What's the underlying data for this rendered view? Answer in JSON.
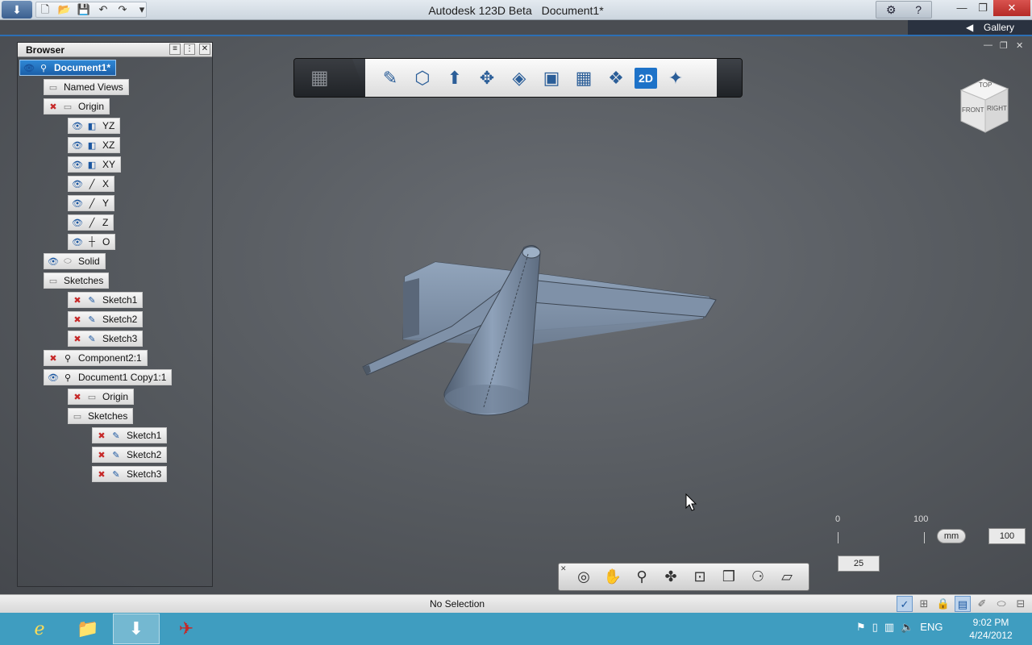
{
  "window": {
    "app_title": "Autodesk 123D Beta",
    "doc_title": "Document1*",
    "minimize_icon": "minimize-icon",
    "maximize_icon": "maximize-icon",
    "close_icon": "close-icon"
  },
  "gallery": {
    "label": "Gallery"
  },
  "browser": {
    "title": "Browser",
    "nodes": [
      {
        "label": "Document1*",
        "icons": [
          "eye",
          "component"
        ],
        "selected": true
      },
      {
        "label": "Named Views",
        "icons": [
          "folder"
        ]
      },
      {
        "label": "Origin",
        "icons": [
          "hidden",
          "folder"
        ]
      },
      {
        "label": "YZ",
        "icons": [
          "eye",
          "plane"
        ]
      },
      {
        "label": "XZ",
        "icons": [
          "eye",
          "plane"
        ]
      },
      {
        "label": "XY",
        "icons": [
          "eye",
          "plane"
        ]
      },
      {
        "label": "X",
        "icons": [
          "eye",
          "axis"
        ]
      },
      {
        "label": "Y",
        "icons": [
          "eye",
          "axis"
        ]
      },
      {
        "label": "Z",
        "icons": [
          "eye",
          "axis"
        ]
      },
      {
        "label": "O",
        "icons": [
          "eye",
          "point"
        ]
      },
      {
        "label": "Solid",
        "icons": [
          "eye",
          "body"
        ]
      },
      {
        "label": "Sketches",
        "icons": [
          "folder"
        ]
      },
      {
        "label": "Sketch1",
        "icons": [
          "hidden",
          "sketch"
        ]
      },
      {
        "label": "Sketch2",
        "icons": [
          "hidden",
          "sketch"
        ]
      },
      {
        "label": "Sketch3",
        "icons": [
          "hidden",
          "sketch"
        ]
      },
      {
        "label": "Component2:1",
        "icons": [
          "hidden",
          "component"
        ]
      },
      {
        "label": "Document1 Copy1:1",
        "icons": [
          "eye",
          "component"
        ]
      },
      {
        "label": "Origin",
        "icons": [
          "hidden",
          "folder"
        ]
      },
      {
        "label": "Sketches",
        "icons": [
          "folder"
        ]
      },
      {
        "label": "Sketch1",
        "icons": [
          "hidden",
          "sketch"
        ]
      },
      {
        "label": "Sketch2",
        "icons": [
          "hidden",
          "sketch"
        ]
      },
      {
        "label": "Sketch3",
        "icons": [
          "hidden",
          "sketch"
        ]
      }
    ]
  },
  "toolbar": {
    "tools": [
      "home-view-icon",
      "sketch-pencil-icon",
      "primitives-box-icon",
      "construct-icon",
      "modify-icon",
      "pattern-icon",
      "combine-icon",
      "grouping-icon",
      "snap-icon",
      "2d-drawing-icon",
      "smart-material-icon"
    ],
    "twoD_label": "2D"
  },
  "viewcube": {
    "top": "TOP",
    "front": "FRONT",
    "right": "RIGHT"
  },
  "scale": {
    "min": "0",
    "max": "100",
    "unit": "mm",
    "value_right": "100",
    "value_below": "25"
  },
  "navbar": {
    "tools": [
      "orbit-icon",
      "pan-icon",
      "zoom-icon",
      "look-icon",
      "fit-icon",
      "view-icon",
      "visual-style-icon",
      "display-icon"
    ]
  },
  "status": {
    "message": "No Selection"
  },
  "taskbar": {
    "language": "ENG",
    "time": "9:02 PM",
    "date": "4/24/2012"
  }
}
